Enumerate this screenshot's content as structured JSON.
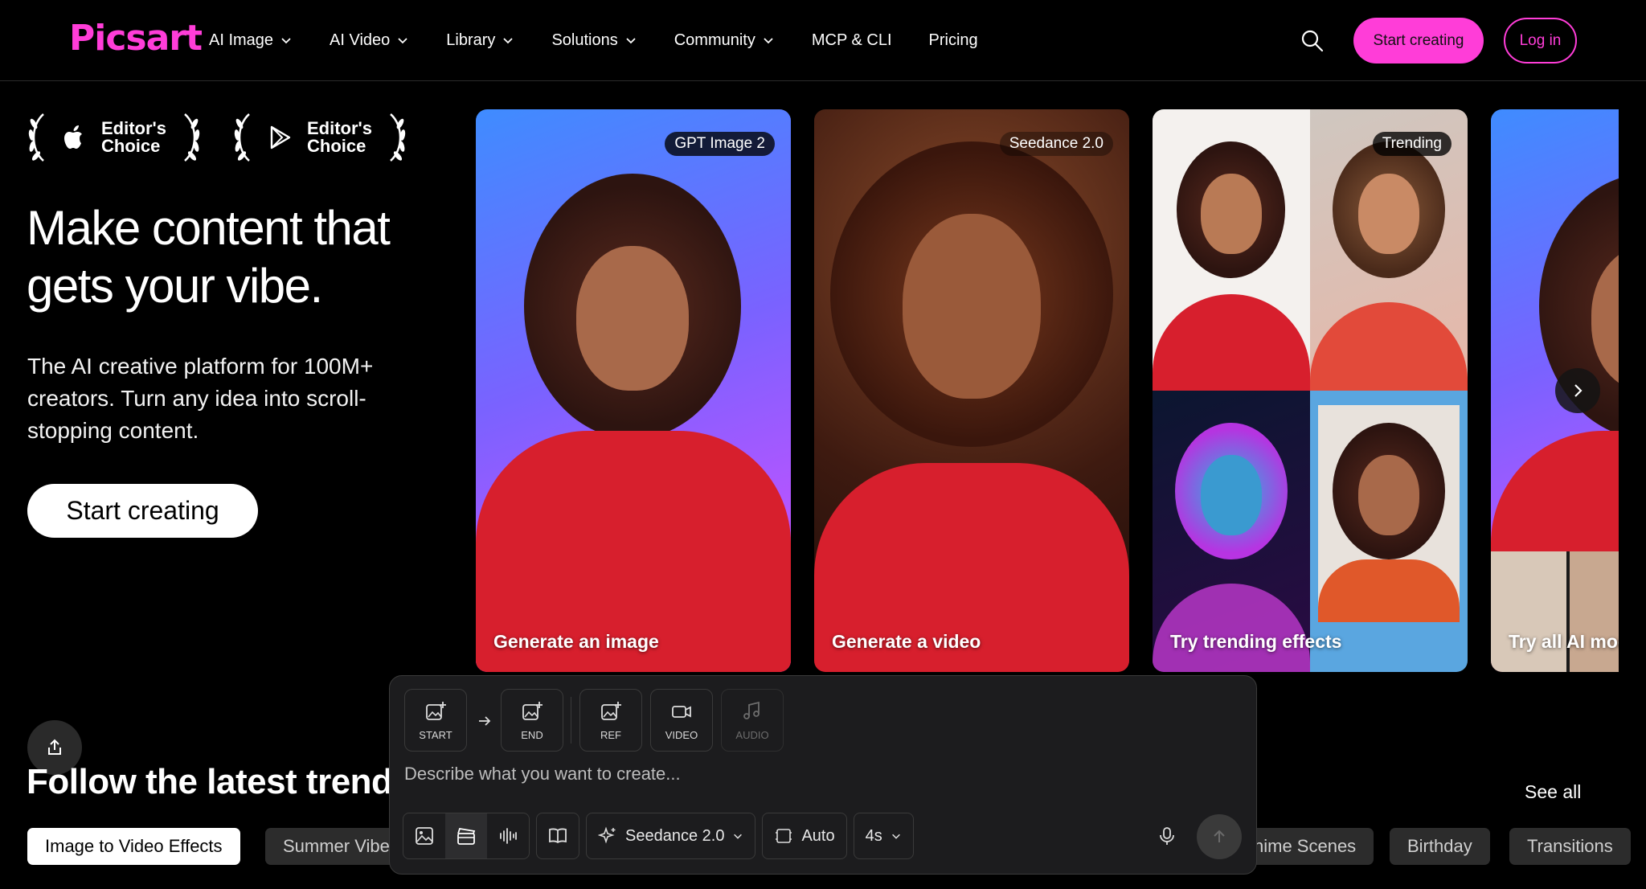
{
  "brand": {
    "logo": "Picsart",
    "accent": "#ff3dd8"
  },
  "nav": {
    "items": [
      {
        "label": "AI Image",
        "dropdown": true
      },
      {
        "label": "AI Video",
        "dropdown": true
      },
      {
        "label": "Library",
        "dropdown": true
      },
      {
        "label": "Solutions",
        "dropdown": true
      },
      {
        "label": "Community",
        "dropdown": true
      },
      {
        "label": "MCP & CLI",
        "dropdown": false
      },
      {
        "label": "Pricing",
        "dropdown": false
      }
    ],
    "start_label": "Start creating",
    "login_label": "Log in"
  },
  "awards": [
    {
      "store": "apple-icon",
      "text": "Editor's Choice"
    },
    {
      "store": "google-play-icon",
      "text": "Editor's Choice"
    }
  ],
  "hero": {
    "title": "Make content that gets your vibe.",
    "subtitle": "The AI creative platform for 100M+ creators. Turn any idea into scroll-stopping content.",
    "cta": "Start creating"
  },
  "cards": [
    {
      "tag": "GPT Image 2",
      "caption": "Generate an image"
    },
    {
      "tag": "Seedance 2.0",
      "caption": "Generate a video"
    },
    {
      "tag": "Trending",
      "caption": "Try trending effects"
    },
    {
      "tag": "",
      "caption": "Try all AI moc"
    }
  ],
  "trends": {
    "title": "Follow the latest trends",
    "see_all": "See all",
    "chips": [
      "Image to Video Effects",
      "Summer Vibe",
      "nime Scenes",
      "Birthday",
      "Transitions"
    ]
  },
  "composer": {
    "tools": [
      "START",
      "END",
      "REF",
      "VIDEO",
      "AUDIO"
    ],
    "placeholder": "Describe what you want to create...",
    "model": "Seedance 2.0",
    "aspect": "Auto",
    "duration": "4s"
  }
}
